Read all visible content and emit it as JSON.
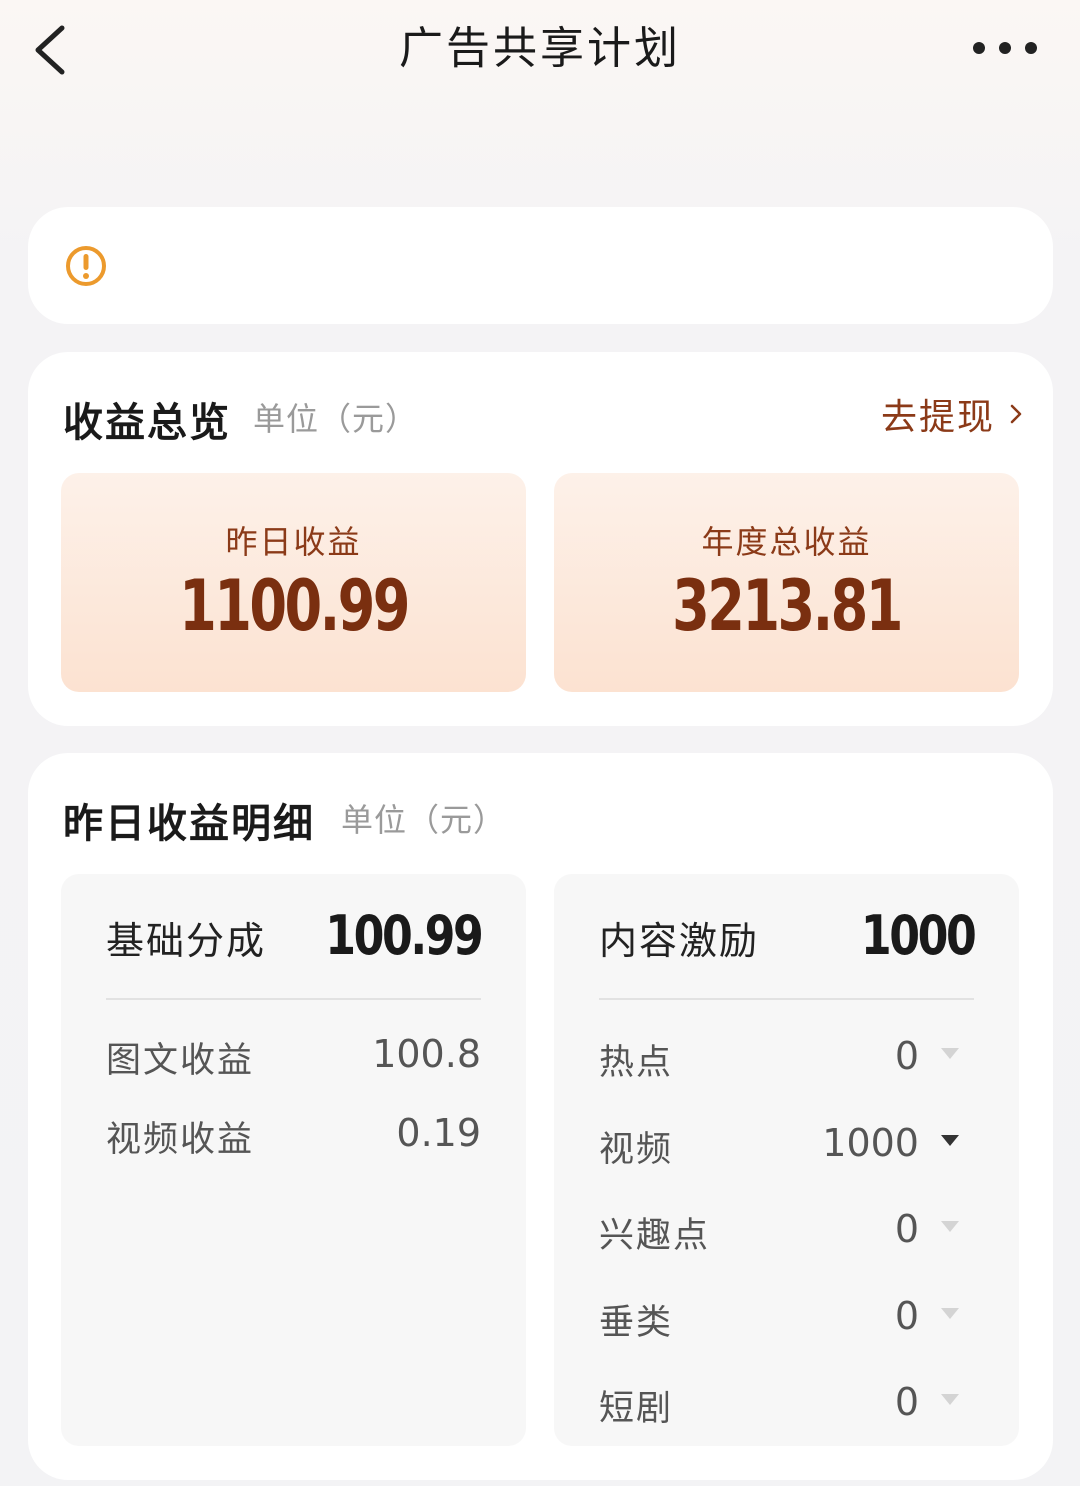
{
  "nav": {
    "title": "广告共享计划"
  },
  "icons": {
    "back": "chevron-left-icon",
    "more": "more-dots-icon",
    "notice": "warning-circle-icon",
    "withdraw_arrow": "chevron-right-icon",
    "expand": "caret-down-icon"
  },
  "colors": {
    "accent_brown": "#8b3a18",
    "value_brown": "#7a2f10",
    "warning_orange": "#ec9a2d"
  },
  "overview": {
    "title": "收益总览",
    "unit": "单位（元）",
    "withdraw_label": "去提现",
    "stats": [
      {
        "label": "昨日收益",
        "value": "1100.99"
      },
      {
        "label": "年度总收益",
        "value": "3213.81"
      }
    ]
  },
  "detail": {
    "title": "昨日收益明细",
    "unit": "单位（元）",
    "base": {
      "name": "基础分成",
      "value": "100.99",
      "rows": [
        {
          "name": "图文收益",
          "value": "100.8"
        },
        {
          "name": "视频收益",
          "value": "0.19"
        }
      ]
    },
    "incentive": {
      "name": "内容激励",
      "value": "1000",
      "rows": [
        {
          "name": "热点",
          "value": "0"
        },
        {
          "name": "视频",
          "value": "1000"
        },
        {
          "name": "兴趣点",
          "value": "0"
        },
        {
          "name": "垂类",
          "value": "0"
        },
        {
          "name": "短剧",
          "value": "0"
        }
      ]
    }
  }
}
